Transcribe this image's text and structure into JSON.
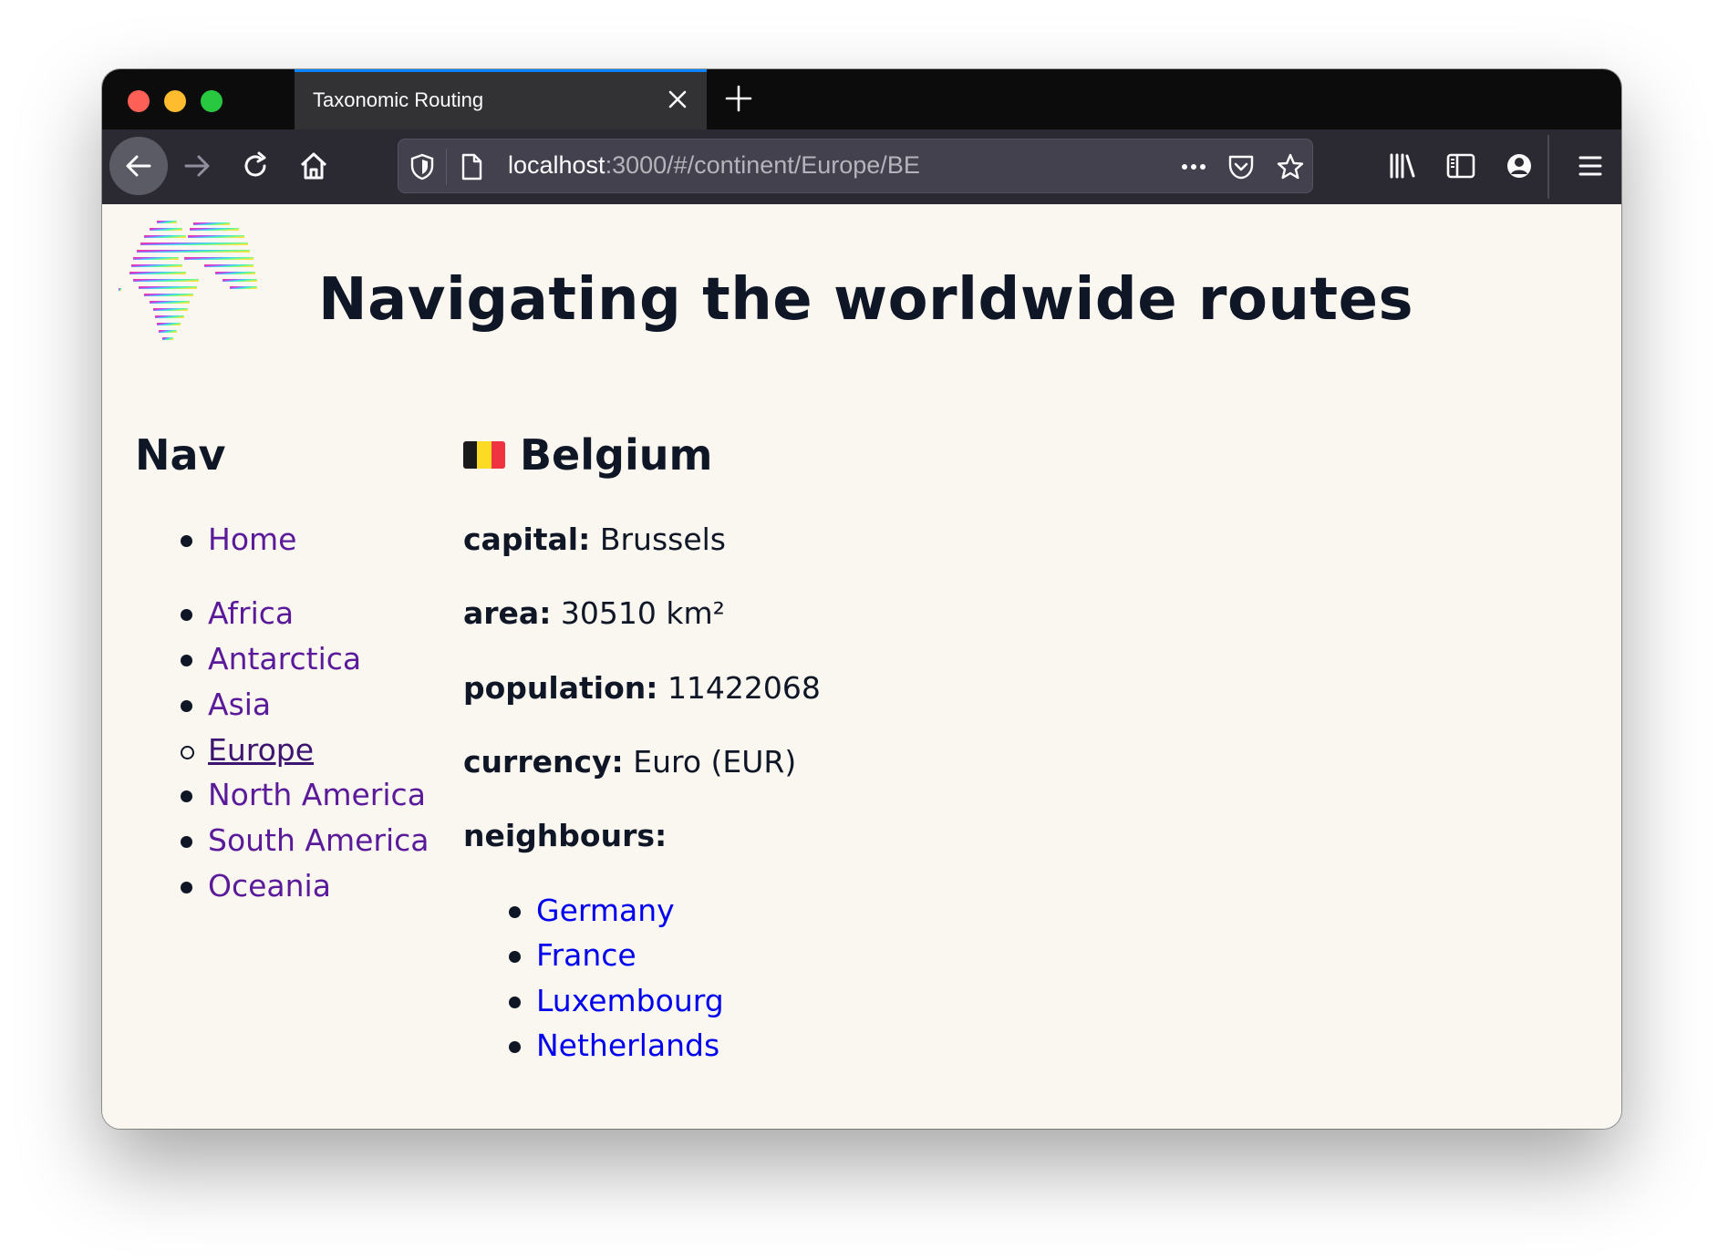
{
  "browser": {
    "tab_title": "Taxonomic Routing",
    "url_host": "localhost",
    "url_rest": ":3000/#/continent/Europe/BE"
  },
  "page": {
    "title": "Navigating the worldwide routes"
  },
  "nav": {
    "heading": "Nav",
    "home": "Home",
    "continents": [
      "Africa",
      "Antarctica",
      "Asia",
      "Europe",
      "North America",
      "South America",
      "Oceania"
    ],
    "current": "Europe"
  },
  "country": {
    "name": "Belgium",
    "flag_colors": [
      "#1a1a1a",
      "#fdda24",
      "#ef3340"
    ],
    "capital_label": "capital:",
    "capital": "Brussels",
    "area_label": "area:",
    "area": "30510 km²",
    "population_label": "population:",
    "population": "11422068",
    "currency_label": "currency:",
    "currency": "Euro (EUR)",
    "neighbours_label": "neighbours:",
    "neighbours": [
      "Germany",
      "France",
      "Luxembourg",
      "Netherlands"
    ]
  },
  "colors": {
    "nav_link": "#5a1a99",
    "neighbour_link": "#0000ee",
    "text": "#0f1626",
    "page_bg": "#faf7f1"
  }
}
